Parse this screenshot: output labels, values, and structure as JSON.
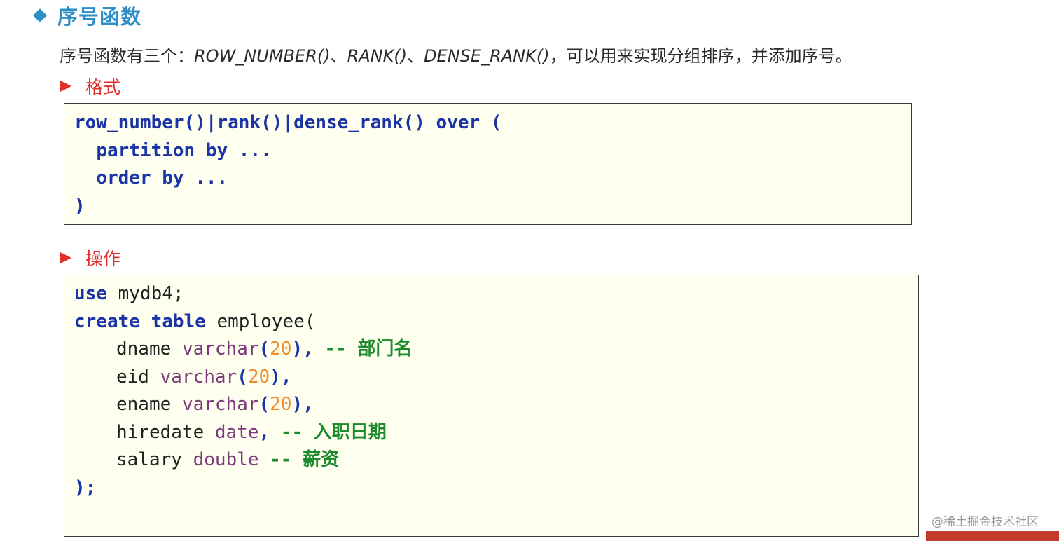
{
  "title": "序号函数",
  "intro": {
    "prefix": "序号函数有三个：",
    "fn1": "ROW_NUMBER()",
    "sep1": "、",
    "fn2": "RANK()",
    "sep2": "、",
    "fn3": "DENSE_RANK()",
    "suffix": "，可以用来实现分组排序，并添加序号。"
  },
  "format_heading": "格式",
  "format_code": {
    "line1": "row_number()|rank()|dense_rank() over (",
    "line2_indent": "  ",
    "line2": "partition by ...",
    "line3_indent": "  ",
    "line3": "order by ...",
    "line4": ")"
  },
  "operation_heading": "操作",
  "operation_code": {
    "use_kw": "use",
    "use_db": " mydb4;",
    "create_kw": "create table",
    "table_name": " employee(",
    "columns": [
      {
        "name": "dname",
        "type": "varchar",
        "size": "20",
        "tail": ",",
        "comment_mark": " --",
        "comment": "部门名"
      },
      {
        "name": "eid",
        "type": "varchar",
        "size": "20",
        "tail": ",",
        "comment_mark": "",
        "comment": ""
      },
      {
        "name": "ename",
        "type": "varchar",
        "size": "20",
        "tail": ",",
        "comment_mark": "",
        "comment": ""
      },
      {
        "name": "hiredate",
        "type": "date",
        "size": "",
        "tail": ",",
        "comment_mark": " --",
        "comment": "入职日期"
      },
      {
        "name": "salary",
        "type": "double",
        "size": "",
        "tail": "",
        "comment_mark": " --",
        "comment": "薪资"
      }
    ],
    "close": ");"
  },
  "watermark": "@稀土掘金技术社区",
  "icons": {
    "title_bullet": "diamond-icon",
    "heading_bullet": "arrow-right-icon"
  },
  "colors": {
    "title": "#2e8fc6",
    "heading": "#e0302c",
    "keyword": "#1a33a6",
    "comment": "#1d8a2c",
    "type": "#7b3a7b",
    "number": "#f08a2a",
    "code_bg": "#fffff0"
  }
}
